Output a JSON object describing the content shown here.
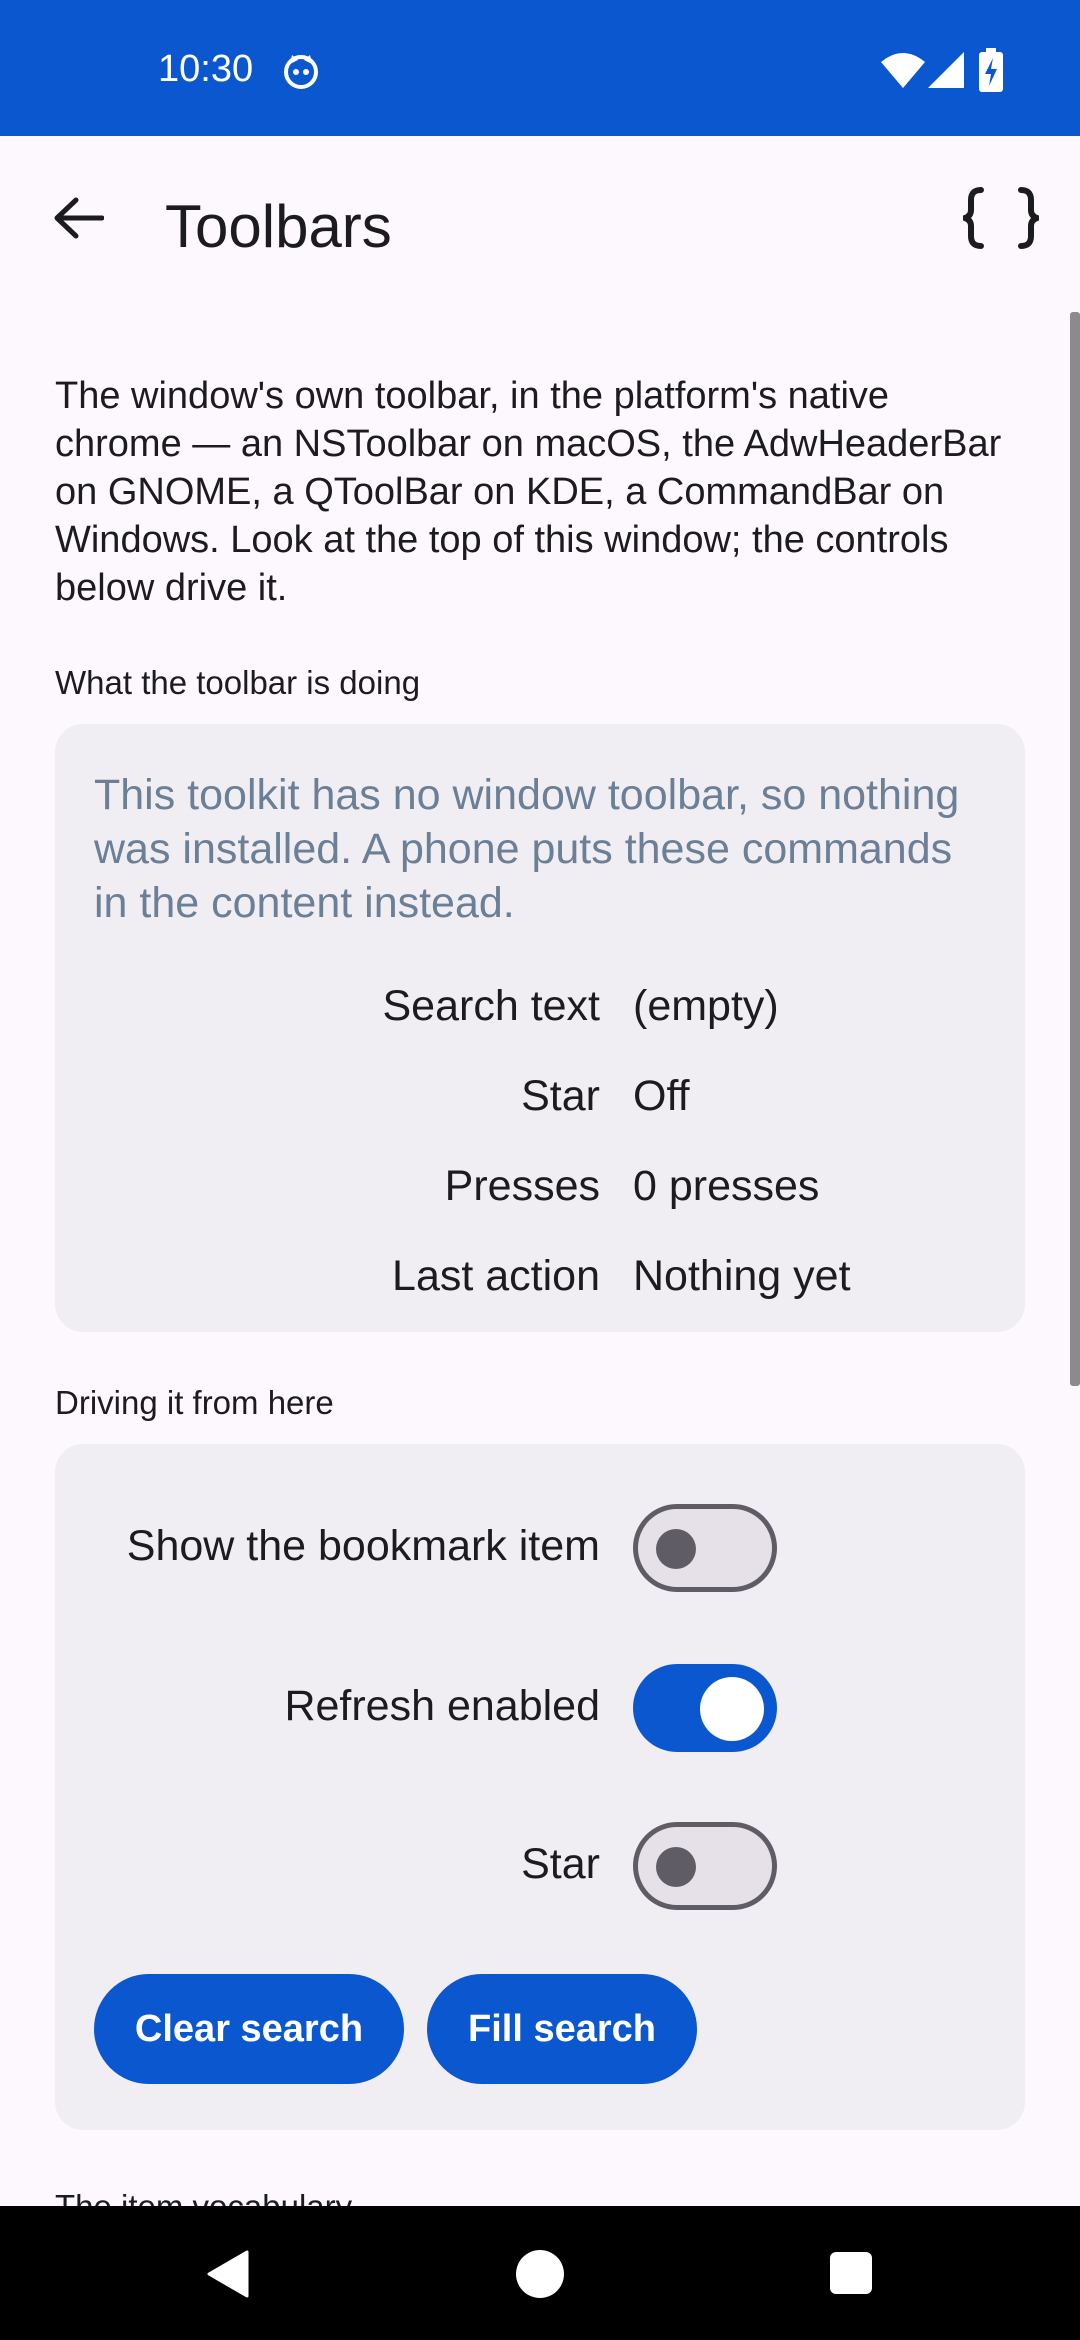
{
  "status_bar": {
    "time": "10:30"
  },
  "app_bar": {
    "title": "Toolbars"
  },
  "intro": "The window's own toolbar, in the platform's native chrome — an NSToolbar on macOS, the AdwHeaderBar on GNOME, a QToolBar on KDE, a CommandBar on Windows. Look at the top of this window; the controls below drive it.",
  "status_section": {
    "label": "What the toolbar is doing",
    "message": "This toolkit has no window toolbar, so nothing was installed. A phone puts these commands in the content instead.",
    "rows": [
      {
        "label": "Search text",
        "value": "(empty)"
      },
      {
        "label": "Star",
        "value": "Off"
      },
      {
        "label": "Presses",
        "value": "0 presses"
      },
      {
        "label": "Last action",
        "value": "Nothing yet"
      }
    ]
  },
  "controls_section": {
    "label": "Driving it from here",
    "toggles": [
      {
        "label": "Show the bookmark item",
        "on": false
      },
      {
        "label": "Refresh enabled",
        "on": true
      },
      {
        "label": "Star",
        "on": false
      }
    ],
    "clear_button": "Clear search",
    "fill_button": "Fill search"
  },
  "next_section": {
    "label": "The item vocabulary"
  },
  "colors": {
    "accent": "#0b57d0",
    "card": "#f1eef3",
    "background": "#fdf8fd",
    "muted_text": "#6b7f96"
  }
}
